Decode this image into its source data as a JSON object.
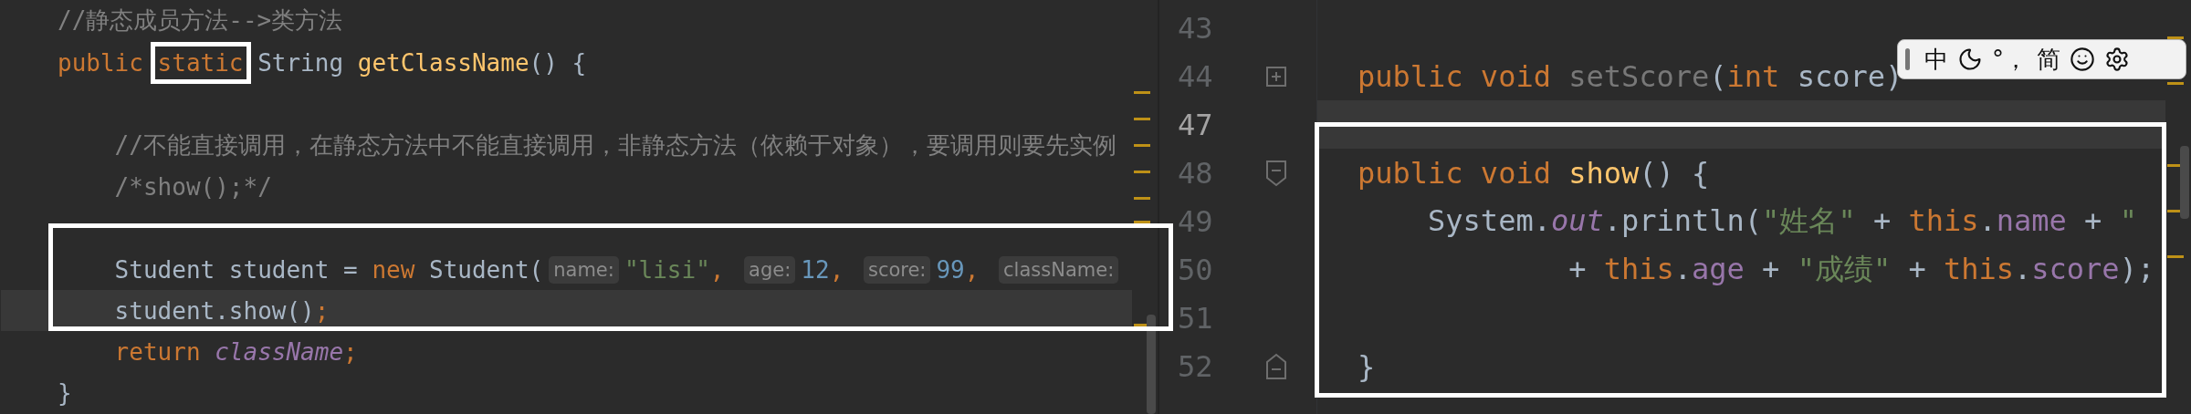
{
  "left_editor": {
    "highlight_frame": true,
    "lines": [
      {
        "current": false,
        "tokens": [
          {
            "kind": "comment",
            "text": "//静态成员方法-->类方法"
          }
        ]
      },
      {
        "current": false,
        "tokens": [
          {
            "kind": "keyword",
            "text": "public "
          },
          {
            "kind": "keyword",
            "text": "static",
            "framed": true
          },
          {
            "kind": "plain",
            "text": " String "
          },
          {
            "kind": "method",
            "text": "getClassName"
          },
          {
            "kind": "plain",
            "text": "() {"
          }
        ]
      },
      {
        "current": false
      },
      {
        "current": false,
        "tokens": [
          {
            "kind": "comment",
            "text": "    //不能直接调用，在静态方法中不能直接调用，非静态方法（依赖于对象），要调用则要先实例"
          }
        ]
      },
      {
        "current": false,
        "tokens": [
          {
            "kind": "comment",
            "text": "    /*show();*/"
          }
        ]
      },
      {
        "current": false
      },
      {
        "current": false,
        "tokens": [
          {
            "kind": "plain",
            "text": "    Student student = "
          },
          {
            "kind": "keyword",
            "text": "new "
          },
          {
            "kind": "plain",
            "text": "Student("
          },
          {
            "kind": "hint",
            "text": "name:"
          },
          {
            "kind": "string",
            "text": "\"lisi\""
          },
          {
            "kind": "keyword",
            "text": ", "
          },
          {
            "kind": "hint",
            "text": "age:"
          },
          {
            "kind": "number",
            "text": "12"
          },
          {
            "kind": "keyword",
            "text": ", "
          },
          {
            "kind": "hint",
            "text": "score:"
          },
          {
            "kind": "number",
            "text": "99"
          },
          {
            "kind": "keyword",
            "text": ", "
          },
          {
            "kind": "hint",
            "text": "className:"
          }
        ]
      },
      {
        "current": true,
        "tokens": [
          {
            "kind": "plain",
            "text": "    student.show()"
          },
          {
            "kind": "keyword",
            "text": ";"
          }
        ]
      },
      {
        "current": false,
        "tokens": [
          {
            "kind": "keyword",
            "text": "    return "
          },
          {
            "kind": "static",
            "text": "className"
          },
          {
            "kind": "keyword",
            "text": ";"
          }
        ]
      },
      {
        "current": false,
        "tokens": [
          {
            "kind": "plain",
            "text": "}"
          }
        ]
      }
    ]
  },
  "right_editor": {
    "highlight_frame": true,
    "lines": [
      {
        "number": "43",
        "current": false,
        "kind": "plain"
      },
      {
        "number": "44",
        "current": false,
        "kind": "fold_start_collapsed",
        "tokens": [
          {
            "kind": "keyword",
            "text": "public void "
          },
          {
            "kind": "unused",
            "text": "setScore"
          },
          {
            "kind": "plain",
            "text": "("
          },
          {
            "kind": "keyword",
            "text": "int "
          },
          {
            "kind": "plain",
            "text": "score)"
          }
        ]
      },
      {
        "number": "47",
        "current": true,
        "kind": "plain"
      },
      {
        "number": "48",
        "current": false,
        "kind": "fold_start",
        "tokens": [
          {
            "kind": "keyword",
            "text": "public void "
          },
          {
            "kind": "method",
            "text": "show"
          },
          {
            "kind": "plain",
            "text": "() {"
          }
        ]
      },
      {
        "number": "49",
        "current": false,
        "kind": "plain",
        "tokens": [
          {
            "kind": "plain",
            "text": "    System."
          },
          {
            "kind": "static",
            "text": "out"
          },
          {
            "kind": "plain",
            "text": ".println("
          },
          {
            "kind": "string",
            "text": "\"姓名\""
          },
          {
            "kind": "plain",
            "text": " + "
          },
          {
            "kind": "keyword",
            "text": "this"
          },
          {
            "kind": "plain",
            "text": "."
          },
          {
            "kind": "field",
            "text": "name"
          },
          {
            "kind": "plain",
            "text": " + "
          },
          {
            "kind": "string",
            "text": "\""
          }
        ]
      },
      {
        "number": "50",
        "current": false,
        "kind": "plain",
        "tokens": [
          {
            "kind": "plain",
            "text": "            + "
          },
          {
            "kind": "keyword",
            "text": "this"
          },
          {
            "kind": "plain",
            "text": "."
          },
          {
            "kind": "field",
            "text": "age"
          },
          {
            "kind": "plain",
            "text": " + "
          },
          {
            "kind": "string",
            "text": "\"成绩\""
          },
          {
            "kind": "plain",
            "text": " + "
          },
          {
            "kind": "keyword",
            "text": "this"
          },
          {
            "kind": "plain",
            "text": "."
          },
          {
            "kind": "field",
            "text": "score"
          },
          {
            "kind": "plain",
            "text": ");"
          }
        ]
      },
      {
        "number": "51",
        "current": false,
        "kind": "plain"
      },
      {
        "number": "52",
        "current": false,
        "kind": "fold_end",
        "tokens": [
          {
            "kind": "plain",
            "text": "}"
          }
        ]
      }
    ]
  },
  "ime_toolbar": {
    "mode": "中",
    "punctuation": "°，",
    "script": "简"
  }
}
